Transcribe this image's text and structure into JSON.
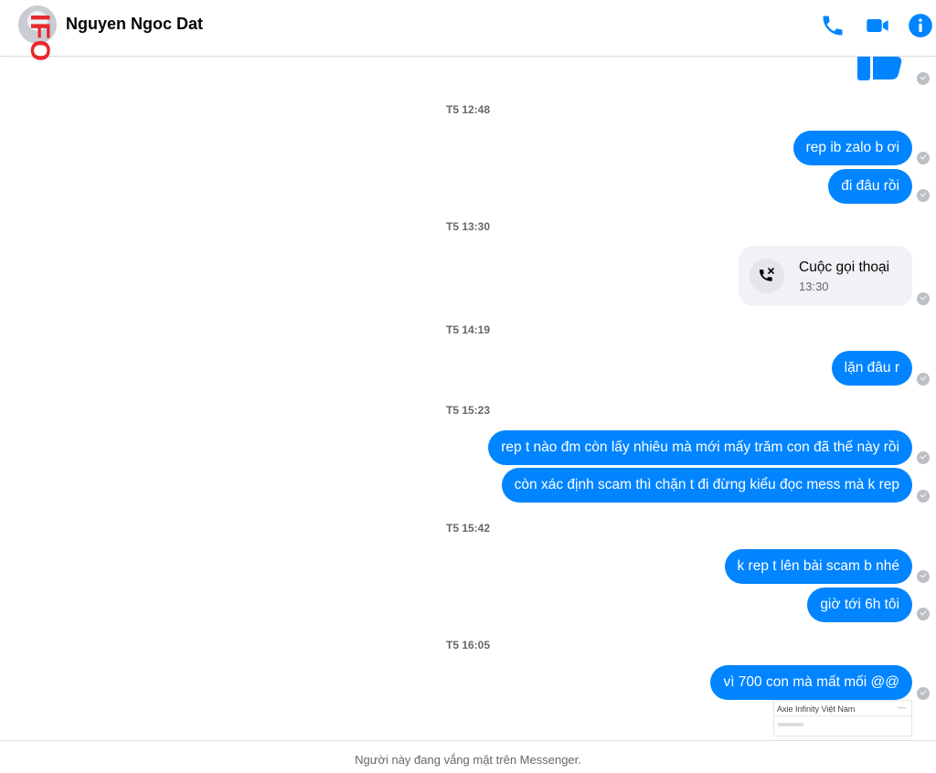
{
  "watermark": "IFO",
  "header": {
    "contact_name": "Nguyen Ngoc Dat"
  },
  "colors": {
    "accent": "#0084ff",
    "watermark": "#e8282d"
  },
  "icons": {
    "call": "phone-icon",
    "video": "video-icon",
    "info": "info-icon"
  },
  "messages": [
    {
      "type": "timestamp",
      "text": "T5 12:48"
    },
    {
      "type": "outgoing",
      "text": "rep ib zalo b ơi"
    },
    {
      "type": "outgoing",
      "text": "đi đâu rồi"
    },
    {
      "type": "timestamp",
      "text": "T5 13:30"
    },
    {
      "type": "call",
      "title": "Cuộc gọi thoại",
      "time": "13:30"
    },
    {
      "type": "timestamp",
      "text": "T5 14:19"
    },
    {
      "type": "outgoing",
      "text": "lặn đâu r"
    },
    {
      "type": "timestamp",
      "text": "T5 15:23"
    },
    {
      "type": "outgoing",
      "text": "rep t nào đm còn lấy nhiêu mà mới mấy trăm con đã thế này rồi"
    },
    {
      "type": "outgoing",
      "text": "còn xác định scam thì chặn t đi đừng kiểu đọc mess mà k rep"
    },
    {
      "type": "timestamp",
      "text": "T5 15:42"
    },
    {
      "type": "outgoing",
      "text": "k rep t lên bài scam b nhé"
    },
    {
      "type": "outgoing",
      "text": "giờ tới 6h tôi"
    },
    {
      "type": "timestamp",
      "text": "T5 16:05"
    },
    {
      "type": "outgoing",
      "text": "vì 700 con mà mất mối @@"
    }
  ],
  "image_preview": {
    "caption": "Axie Infinity Việt Nam"
  },
  "footer": {
    "status_text": "Người này đang vắng mặt trên Messenger."
  }
}
